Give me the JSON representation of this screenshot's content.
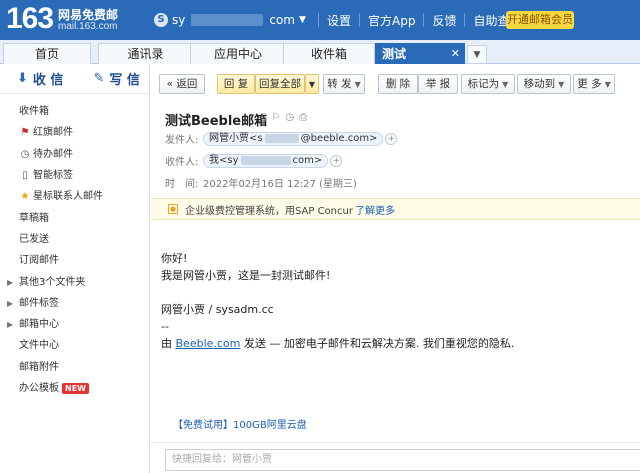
{
  "header": {
    "logo_number": "163",
    "logo_name": "网易免费邮",
    "logo_domain": "mail.163.com",
    "account_icon": "S",
    "account_prefix": "sy",
    "account_suffix": "com",
    "links": [
      "设置",
      "官方App",
      "反馈",
      "自助查询"
    ],
    "vip_button": "开通邮箱会员"
  },
  "tabs": [
    {
      "label": "首页"
    },
    {
      "label": "通讯录"
    },
    {
      "label": "应用中心"
    },
    {
      "label": "收件箱"
    },
    {
      "label": "测试Beeble..."
    }
  ],
  "tab_close": "✕",
  "sidebar": {
    "receive_label": "收 信",
    "write_label": "写 信",
    "folders": [
      {
        "label": "收件箱",
        "icon": ""
      },
      {
        "label": "红旗邮件",
        "icon": "flag-icon"
      },
      {
        "label": "待办邮件",
        "icon": "clock-icon"
      },
      {
        "label": "智能标签",
        "icon": "bookmark-icon"
      },
      {
        "label": "星标联系人邮件",
        "icon": "star-icon"
      },
      {
        "label": "草稿箱",
        "icon": ""
      },
      {
        "label": "已发送",
        "icon": ""
      },
      {
        "label": "订阅邮件",
        "icon": ""
      },
      {
        "label": "其他3个文件夹",
        "icon": "",
        "expandable": true
      },
      {
        "label": "邮件标签",
        "icon": "",
        "expandable": true
      },
      {
        "label": "邮箱中心",
        "icon": "",
        "expandable": true
      },
      {
        "label": "文件中心",
        "icon": ""
      },
      {
        "label": "邮箱附件",
        "icon": ""
      },
      {
        "label": "办公模板",
        "icon": "",
        "badge": "NEW"
      }
    ]
  },
  "toolbar": {
    "back": "« 返回",
    "reply": "回 复",
    "reply_all": "回复全部",
    "forward": "转 发",
    "delete": "删 除",
    "report": "举 报",
    "mark_as": "标记为",
    "move_to": "移动到",
    "more": "更 多"
  },
  "mail": {
    "subject": "测试Beeble邮箱",
    "from_label": "发件人:",
    "from_name": "网管小贾",
    "from_prefix": "<s",
    "from_domain": "@beeble.com>",
    "to_label": "收件人:",
    "to_name": "我",
    "to_prefix": "<sy",
    "to_suffix": "com>",
    "time_label": "时　间:",
    "time_value": "2022年02月16日 12:27 (星期三)",
    "notice_text": "企业级费控管理系统，用SAP Concur",
    "notice_link": "了解更多",
    "body": {
      "line1": "你好!",
      "line2": "我是网管小贾，这是一封测试邮件!",
      "line3": "网管小贾 / sysadm.cc",
      "line4": "--",
      "line5_prefix": "由 ",
      "line5_link": "Beeble.com",
      "line5_suffix": " 发送 — 加密电子邮件和云解决方案. 我们重视您的隐私."
    },
    "promo": "【免费试用】100GB阿里云盘",
    "quick_reply_placeholder": "快捷回复给：网管小贾"
  }
}
